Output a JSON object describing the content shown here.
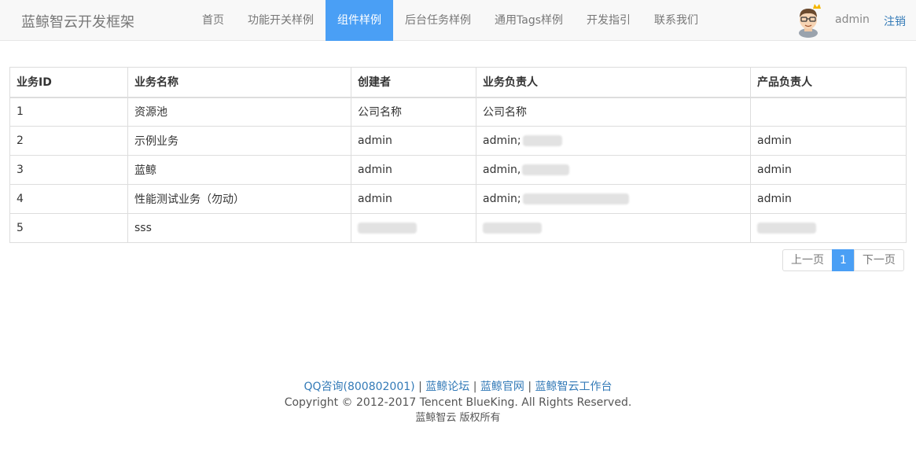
{
  "nav": {
    "brand": "蓝鲸智云开发框架",
    "items": [
      {
        "label": "首页"
      },
      {
        "label": "功能开关样例"
      },
      {
        "label": "组件样例",
        "active": true
      },
      {
        "label": "后台任务样例"
      },
      {
        "label": "通用Tags样例"
      },
      {
        "label": "开发指引"
      },
      {
        "label": "联系我们"
      }
    ],
    "user": "admin",
    "logout": "注销",
    "avatar_icon": "cartoon-avatar-with-crown"
  },
  "table": {
    "headers": [
      "业务ID",
      "业务名称",
      "创建者",
      "业务负责人",
      "产品负责人"
    ],
    "rows": [
      {
        "id": "1",
        "name": "资源池",
        "creator": "公司名称",
        "maintainers": "公司名称",
        "product_owner": ""
      },
      {
        "id": "2",
        "name": "示例业务",
        "creator": "admin",
        "maintainers": "admin;",
        "product_owner": "admin"
      },
      {
        "id": "3",
        "name": "蓝鲸",
        "creator": "admin",
        "maintainers": "admin,",
        "product_owner": "admin"
      },
      {
        "id": "4",
        "name": "性能测试业务（勿动）",
        "creator": "admin",
        "maintainers": "admin;",
        "product_owner": "admin"
      },
      {
        "id": "5",
        "name": "sss",
        "creator": "",
        "maintainers": "",
        "product_owner": ""
      }
    ]
  },
  "pagination": {
    "prev": "上一页",
    "current": "1",
    "next": "下一页"
  },
  "footer": {
    "links": [
      "QQ咨询(800802001)",
      "蓝鲸论坛",
      "蓝鲸官网",
      "蓝鲸智云工作台"
    ],
    "separator": "|",
    "copyright": "Copyright © 2012-2017 Tencent BlueKing. All Rights Reserved.",
    "rights": "蓝鲸智云 版权所有"
  },
  "colors": {
    "active_nav": "#4a9ff5",
    "link": "#337ab7"
  }
}
